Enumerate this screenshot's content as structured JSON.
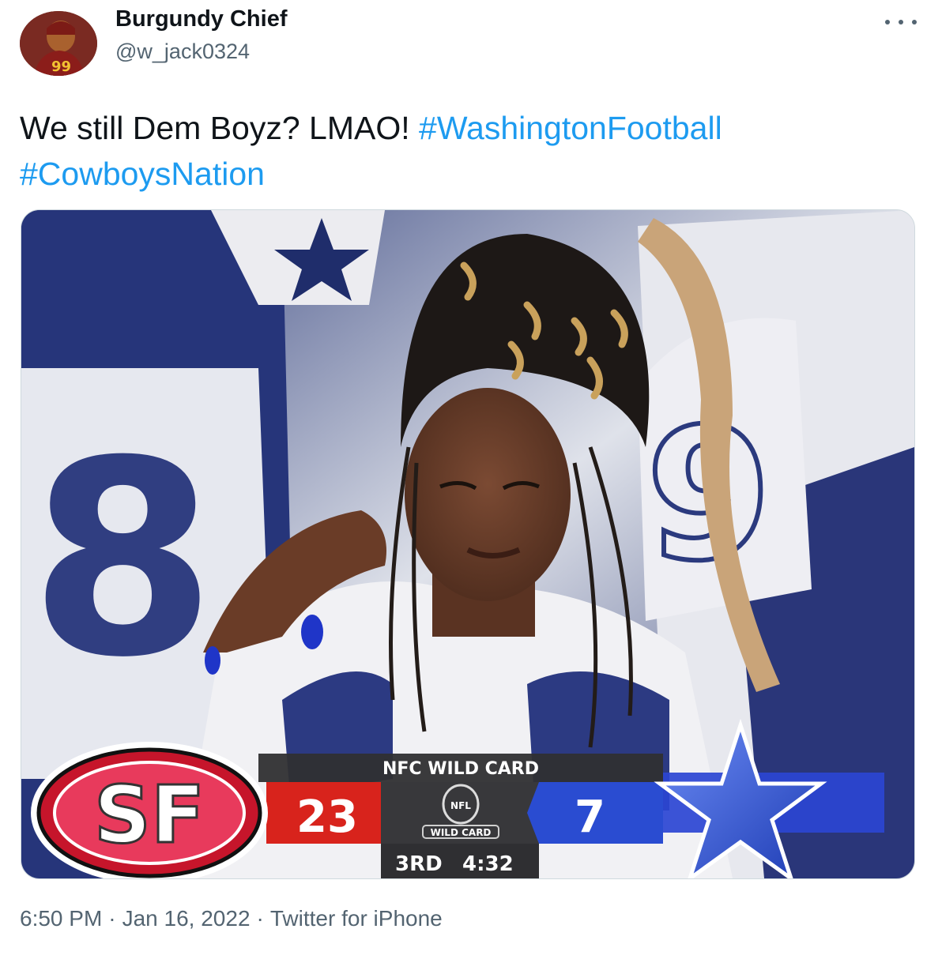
{
  "tweet": {
    "author": {
      "display_name": "Burgundy Chief",
      "handle": "@w_jack0324",
      "avatar_jersey_number": "99"
    },
    "text": {
      "body": "We still Dem Boyz? LMAO! ",
      "hashtags": [
        "#WashingtonFootball",
        "#CowboysNation"
      ]
    },
    "media": {
      "scorebug": {
        "title": "NFC WILD CARD",
        "home_score": "23",
        "away_score": "7",
        "period": "3RD",
        "clock": "4:32",
        "badge": "WILD CARD",
        "nfl_mark": "NFL",
        "team_left_logo": "SF",
        "colors": {
          "left_team": "#d8231c",
          "right_team": "#2a4cd1",
          "bar": "#3a3a3c"
        }
      }
    },
    "meta": {
      "time": "6:50 PM",
      "date": "Jan 16, 2022",
      "source": "Twitter for iPhone",
      "separator": "·"
    }
  }
}
